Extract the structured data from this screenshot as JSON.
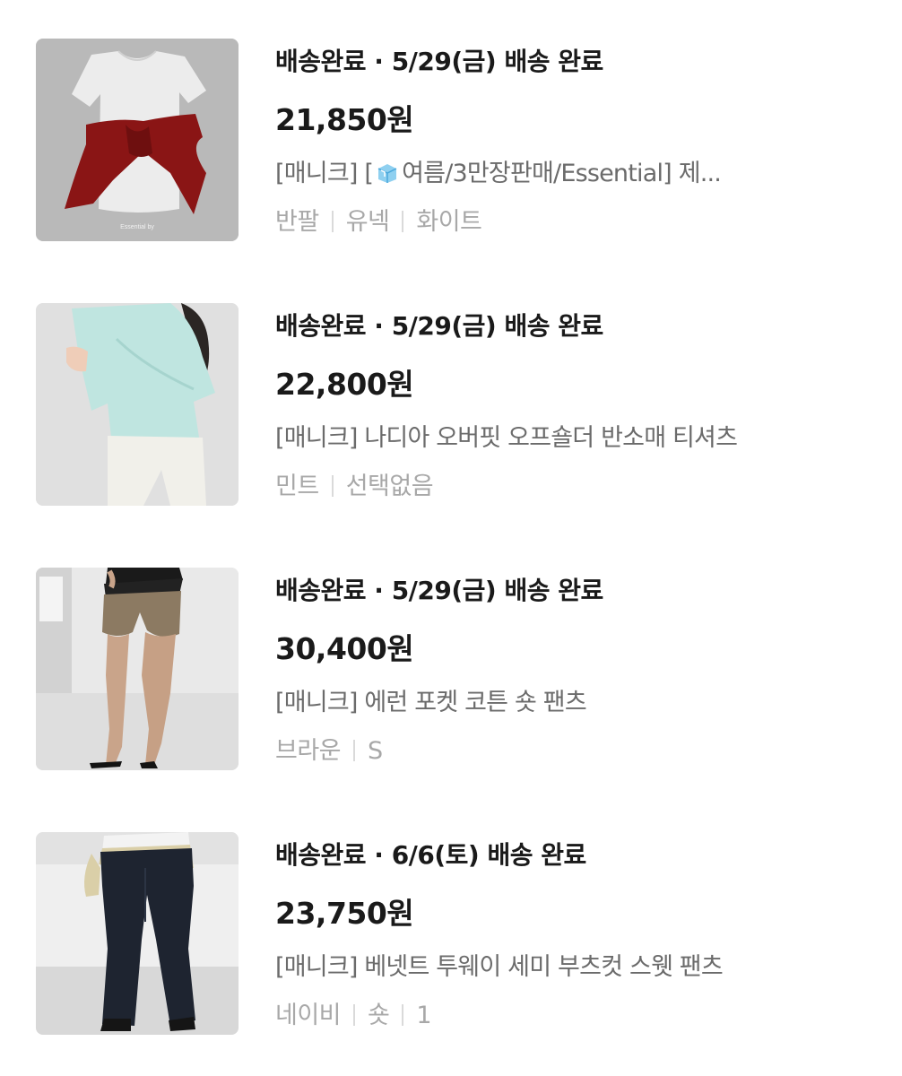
{
  "orders": [
    {
      "status": "배송완료",
      "separator": " · ",
      "delivery": "5/29(금) 배송 완료",
      "price": "21,850원",
      "name_prefix": "[매니크] [",
      "name_icon": "ice-cube-emoji",
      "name_suffix": "여름/3만장판매/Essential] 제...",
      "options": [
        "반팔",
        "유넥",
        "화이트"
      ],
      "thumb_caption": "Essential by"
    },
    {
      "status": "배송완료",
      "separator": " · ",
      "delivery": "5/29(금) 배송 완료",
      "price": "22,800원",
      "name": "[매니크] 나디아 오버핏 오프숄더 반소매 티셔츠",
      "options": [
        "민트",
        "선택없음"
      ]
    },
    {
      "status": "배송완료",
      "separator": " · ",
      "delivery": "5/29(금) 배송 완료",
      "price": "30,400원",
      "name": "[매니크] 에런 포켓 코튼 숏 팬츠",
      "options": [
        "브라운",
        "S"
      ]
    },
    {
      "status": "배송완료",
      "separator": " · ",
      "delivery": "6/6(토) 배송 완료",
      "price": "23,750원",
      "name": "[매니크] 베넷트 투웨이 세미 부츠컷 스웻 팬츠",
      "options": [
        "네이비",
        "숏",
        "1"
      ]
    }
  ],
  "colors": {
    "title": "#1a1a1a",
    "name": "#6b6b6b",
    "options": "#a8a8a8",
    "separator": "#dadada"
  }
}
